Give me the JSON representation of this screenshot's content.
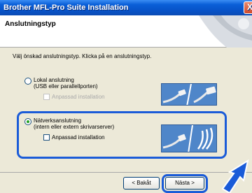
{
  "window": {
    "title": "Brother MFL-Pro Suite Installation",
    "close_symbol": "X"
  },
  "header": {
    "title": "Anslutningstyp"
  },
  "instruction": "Välj önskad anslutningstyp. Klicka på en anslutningstyp.",
  "options": [
    {
      "label_line1": "Lokal anslutning",
      "label_line2": "(USB eller parallellporten)",
      "checkbox_label": "Anpassad installation",
      "selected": false,
      "checkbox_enabled": false
    },
    {
      "label_line1": "Nätverksanslutning",
      "label_line2": "(intern eller extern skrivarserver)",
      "checkbox_label": "Anpassad installation",
      "selected": true,
      "checkbox_enabled": true
    }
  ],
  "buttons": {
    "back_label": "< Bakåt",
    "next_label": "Nästa >"
  },
  "colors": {
    "titlebar": "#0752c7",
    "highlight": "#1a5bd8",
    "image_panel": "#4a7fc1"
  },
  "icons": [
    "usb-cable-icon",
    "parallel-cable-icon",
    "network-cable-icon",
    "wireless-icon",
    "pointer-arrow-icon"
  ]
}
